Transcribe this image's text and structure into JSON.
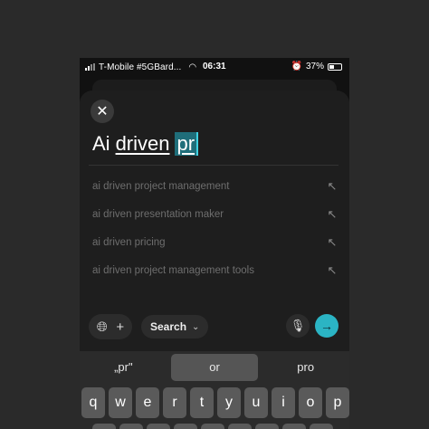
{
  "status_bar": {
    "carrier": "T-Mobile #5GBard...",
    "time": "06:31",
    "battery": "37%"
  },
  "search": {
    "query_parts": [
      "Ai",
      "driven",
      "pr"
    ]
  },
  "suggestions": [
    "ai driven project management",
    "ai driven presentation maker",
    "ai driven pricing",
    "ai driven project management tools"
  ],
  "toolbar": {
    "search_mode_label": "Search"
  },
  "keyboard": {
    "predictions": [
      "„pr\"",
      "or",
      "pro"
    ],
    "row1": [
      "q",
      "w",
      "e",
      "r",
      "t",
      "y",
      "u",
      "i",
      "o",
      "p"
    ]
  },
  "colors": {
    "accent": "#2bb4c4",
    "highlight": "#1f6e7a"
  }
}
